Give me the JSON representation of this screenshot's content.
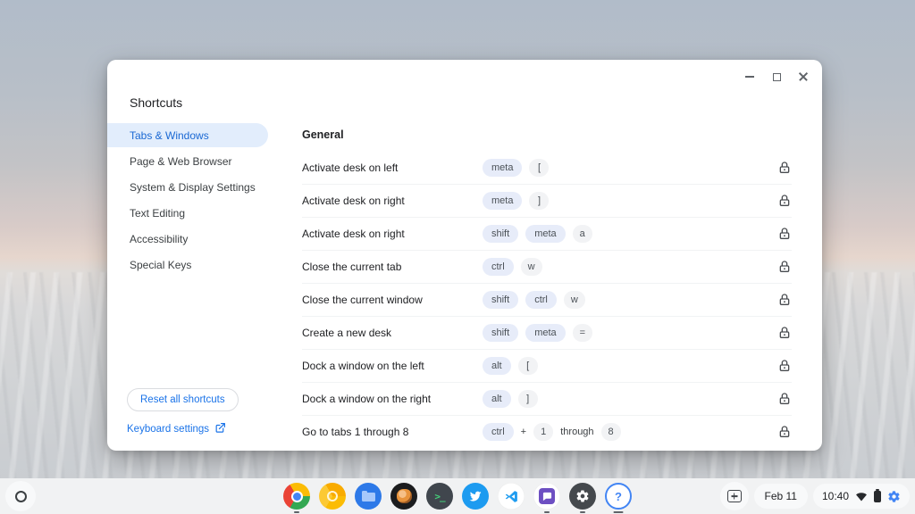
{
  "window": {
    "title": "Shortcuts",
    "controls": [
      "minimize-icon",
      "maximize-icon",
      "close-icon"
    ],
    "sidebar": {
      "items": [
        {
          "label": "Tabs & Windows",
          "selected": true
        },
        {
          "label": "Page & Web Browser",
          "selected": false
        },
        {
          "label": "System & Display Settings",
          "selected": false
        },
        {
          "label": "Text Editing",
          "selected": false
        },
        {
          "label": "Accessibility",
          "selected": false
        },
        {
          "label": "Special Keys",
          "selected": false
        }
      ],
      "reset_label": "Reset all shortcuts",
      "keyboard_settings_label": "Keyboard settings",
      "keyboard_settings_icon": "external-link-icon"
    },
    "content": {
      "section_title": "General",
      "lock_icon": "lock-icon",
      "rows": [
        {
          "label": "Activate desk on left",
          "keys": [
            {
              "text": "meta",
              "style": "modifier"
            },
            {
              "text": "[",
              "style": "key"
            }
          ],
          "locked": true
        },
        {
          "label": "Activate desk on right",
          "keys": [
            {
              "text": "meta",
              "style": "modifier"
            },
            {
              "text": "]",
              "style": "key"
            }
          ],
          "locked": true
        },
        {
          "label": "Activate desk on right",
          "keys": [
            {
              "text": "shift",
              "style": "modifier"
            },
            {
              "text": "meta",
              "style": "modifier"
            },
            {
              "text": "a",
              "style": "key"
            }
          ],
          "locked": true
        },
        {
          "label": "Close the current tab",
          "keys": [
            {
              "text": "ctrl",
              "style": "modifier"
            },
            {
              "text": "w",
              "style": "key"
            }
          ],
          "locked": true
        },
        {
          "label": "Close the current window",
          "keys": [
            {
              "text": "shift",
              "style": "modifier"
            },
            {
              "text": "ctrl",
              "style": "modifier"
            },
            {
              "text": "w",
              "style": "key"
            }
          ],
          "locked": true
        },
        {
          "label": "Create a new desk",
          "keys": [
            {
              "text": "shift",
              "style": "modifier"
            },
            {
              "text": "meta",
              "style": "modifier"
            },
            {
              "text": "=",
              "style": "key"
            }
          ],
          "locked": true
        },
        {
          "label": "Dock a window on the left",
          "keys": [
            {
              "text": "alt",
              "style": "modifier"
            },
            {
              "text": "[",
              "style": "key"
            }
          ],
          "locked": true
        },
        {
          "label": "Dock a window on the right",
          "keys": [
            {
              "text": "alt",
              "style": "modifier"
            },
            {
              "text": "]",
              "style": "key"
            }
          ],
          "locked": true
        },
        {
          "label": "Go to tabs 1 through 8",
          "keys": [
            {
              "text": "ctrl",
              "style": "modifier"
            },
            {
              "text": "+",
              "style": "plain"
            },
            {
              "text": "1",
              "style": "key"
            },
            {
              "text": "through",
              "style": "plain"
            },
            {
              "text": "8",
              "style": "key"
            }
          ],
          "locked": true
        }
      ]
    }
  },
  "shelf": {
    "launcher_icon": "launcher-icon",
    "apps": [
      {
        "name": "chrome",
        "icon": "chrome-icon",
        "running": true,
        "active": false
      },
      {
        "name": "chrome-canary",
        "icon": "chrome-canary-icon",
        "running": false,
        "active": false
      },
      {
        "name": "files",
        "icon": "files-folder-icon",
        "running": false,
        "active": false
      },
      {
        "name": "game",
        "icon": "dark-orange-app-icon",
        "running": false,
        "active": false
      },
      {
        "name": "terminal",
        "icon": "terminal-icon",
        "running": false,
        "active": false
      },
      {
        "name": "twitter",
        "icon": "twitter-bird-icon",
        "running": false,
        "active": false
      },
      {
        "name": "vscode",
        "icon": "vscode-icon",
        "running": false,
        "active": false
      },
      {
        "name": "chat",
        "icon": "chat-app-icon",
        "running": true,
        "active": false
      },
      {
        "name": "settings",
        "icon": "settings-gear-icon",
        "running": true,
        "active": false
      },
      {
        "name": "explore",
        "icon": "explore-help-icon",
        "running": true,
        "active": true
      }
    ],
    "tray": {
      "capture_icon": "screen-capture-icon",
      "date": "Feb 11",
      "time": "10:40",
      "status_icons": [
        "wifi-icon",
        "battery-icon",
        "update-gear-icon"
      ]
    }
  },
  "colors": {
    "accent": "#1a73e8",
    "selected_pill_bg": "#e2edfc",
    "modifier_pill_bg": "#e7ecf9",
    "key_pill_bg": "#f2f3f5",
    "shelf_bg": "#f1f2f3"
  }
}
